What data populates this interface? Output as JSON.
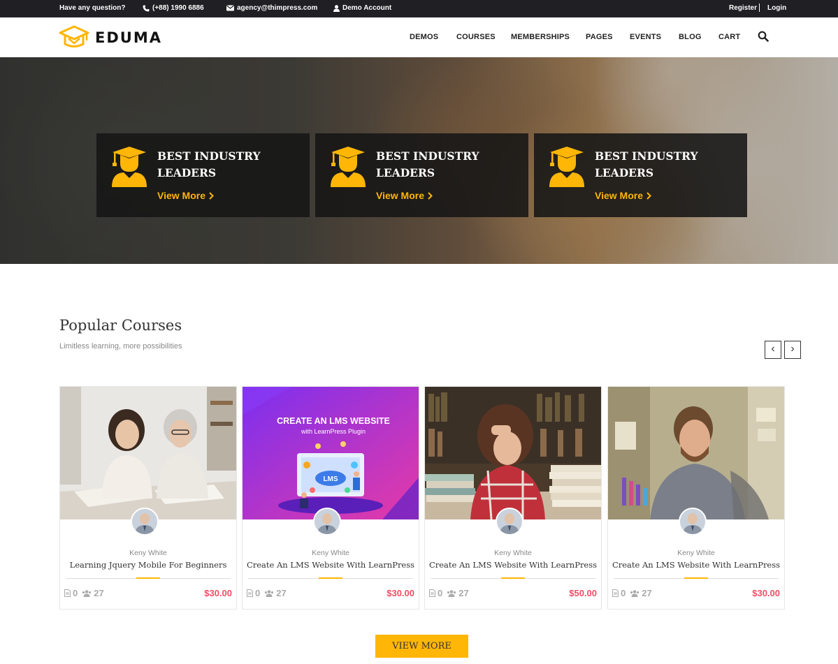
{
  "topbar": {
    "question": "Have any question?",
    "phone": "(+88) 1990 6886",
    "email": "agency@thimpress.com",
    "demo_account": "Demo Account",
    "register": "Register",
    "login": "Login"
  },
  "brand": {
    "name": "EDUMA",
    "accent": "#ffb606"
  },
  "nav": {
    "items": [
      "DEMOS",
      "COURSES",
      "MEMBERSHIPS",
      "PAGES",
      "EVENTS",
      "BLOG",
      "CART"
    ],
    "search_icon": "search-icon"
  },
  "features": [
    {
      "title_line1": "BEST INDUSTRY",
      "title_line2": "LEADERS",
      "link": "View More",
      "icon": "graduate-icon"
    },
    {
      "title_line1": "BEST INDUSTRY",
      "title_line2": "LEADERS",
      "link": "View More",
      "icon": "graduate-icon"
    },
    {
      "title_line1": "BEST INDUSTRY",
      "title_line2": "LEADERS",
      "link": "View More",
      "icon": "graduate-icon"
    }
  ],
  "popular": {
    "title": "Popular Courses",
    "subtitle": "Limitless learning, more possibilities",
    "prev": "‹",
    "next": "›",
    "courses": [
      {
        "author": "Keny White",
        "title": "Learning Jquery Mobile For Beginners",
        "lessons": "0",
        "students": "27",
        "price": "$30.00"
      },
      {
        "author": "Keny White",
        "title": "Create An LMS Website With LearnPress",
        "lessons": "0",
        "students": "27",
        "price": "$30.00",
        "banner_title": "CREATE AN LMS WEBSITE",
        "banner_sub": "with LearnPress Plugin",
        "banner_badge": "LMS"
      },
      {
        "author": "Keny White",
        "title": "Create An LMS Website With LearnPress",
        "lessons": "0",
        "students": "27",
        "price": "$50.00"
      },
      {
        "author": "Keny White",
        "title": "Create An LMS Website With LearnPress",
        "lessons": "0",
        "students": "27",
        "price": "$30.00"
      }
    ],
    "view_more": "VIEW MORE"
  },
  "colors": {
    "accent": "#ffb606",
    "price": "#f24c64",
    "topbar": "#1f1f24"
  }
}
